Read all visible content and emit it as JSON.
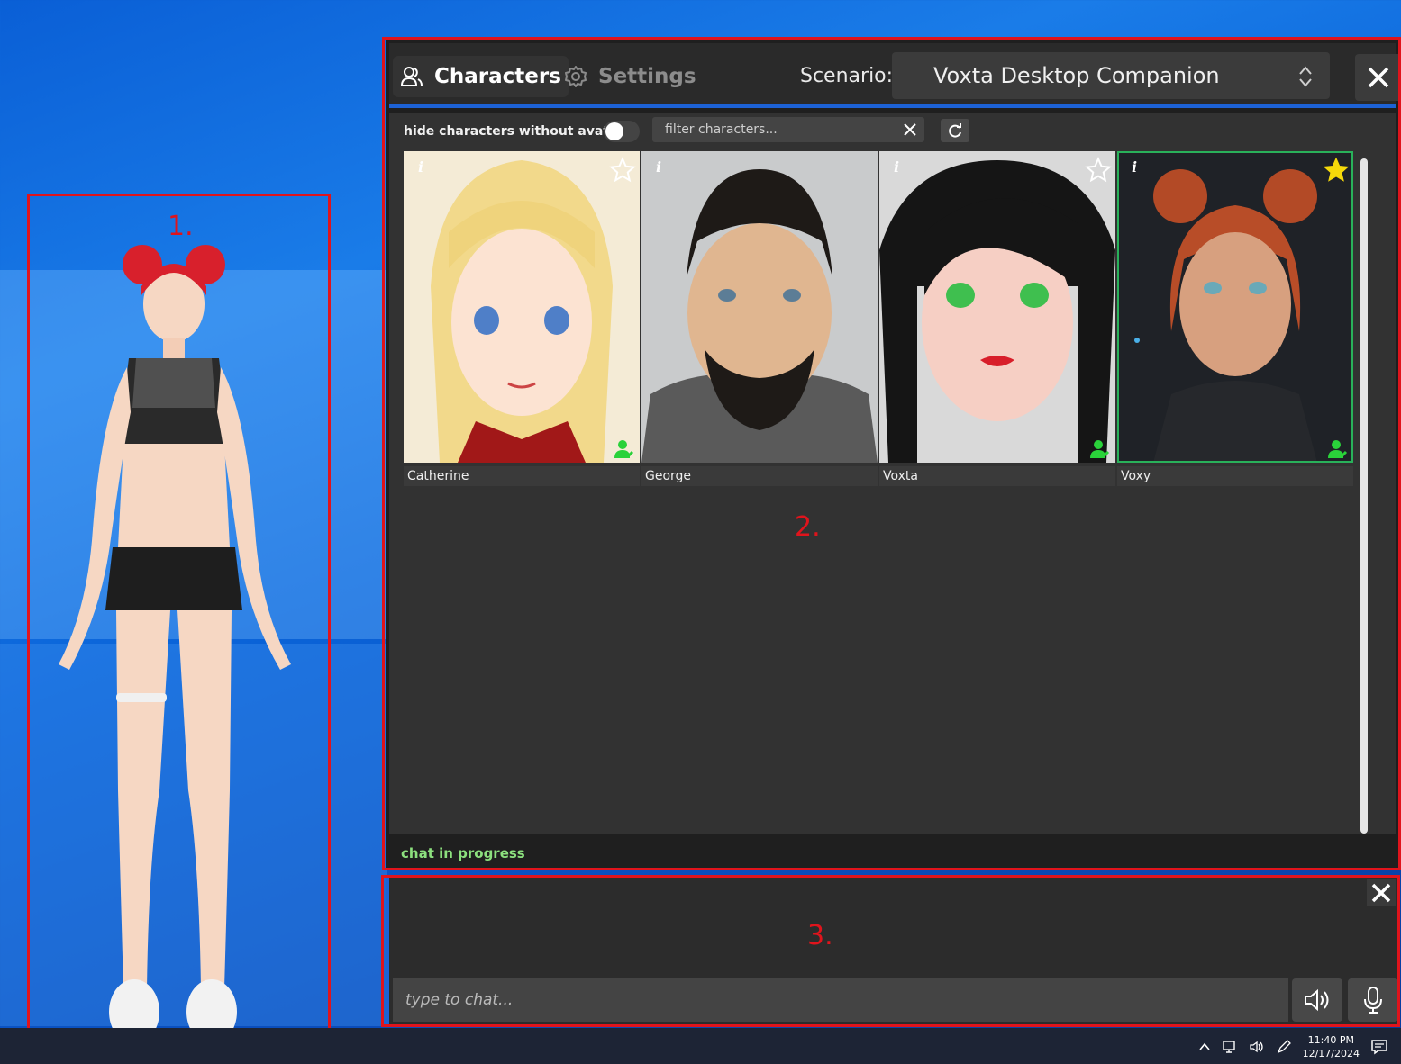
{
  "annotations": [
    "1.",
    "2.",
    "3."
  ],
  "window": {
    "tabs": [
      {
        "label": "Characters",
        "icon": "people-icon",
        "active": true
      },
      {
        "label": "Settings",
        "icon": "gear-icon",
        "active": false
      }
    ],
    "scenario_label": "Scenario:",
    "scenario_value": "Voxta Desktop Companion"
  },
  "toolbar": {
    "hide_label": "hide characters without avatar",
    "filter_placeholder": "filter characters..."
  },
  "characters": [
    {
      "name": "Catherine",
      "favorite": false,
      "has_person_badge": true,
      "selected": false
    },
    {
      "name": "George",
      "favorite": false,
      "has_person_badge": false,
      "selected": false
    },
    {
      "name": "Voxta",
      "favorite": false,
      "has_person_badge": true,
      "selected": false
    },
    {
      "name": "Voxy",
      "favorite": true,
      "has_person_badge": true,
      "selected": true
    }
  ],
  "status": "chat in progress",
  "chat": {
    "placeholder": "type to chat..."
  },
  "taskbar": {
    "time": "11:40 PM",
    "date": "12/17/2024"
  },
  "colors": {
    "accent_blue": "#1d62d6",
    "annotation_red": "#e0141c",
    "status_green": "#8ce07e",
    "favorite_yellow": "#f5d90a",
    "badge_green": "#2ad23a"
  }
}
